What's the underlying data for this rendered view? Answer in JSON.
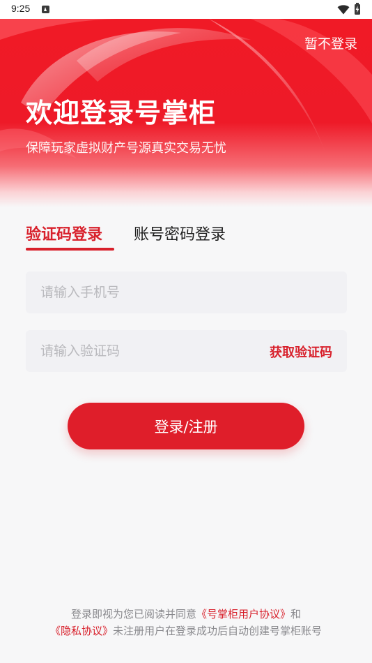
{
  "status_bar": {
    "time": "9:25"
  },
  "header": {
    "skip_label": "暂不登录",
    "title": "欢迎登录号掌柜",
    "subtitle": "保障玩家虚拟财产号源真实交易无忧"
  },
  "tabs": [
    {
      "label": "验证码登录",
      "active": true
    },
    {
      "label": "账号密码登录",
      "active": false
    }
  ],
  "form": {
    "phone_placeholder": "请输入手机号",
    "code_placeholder": "请输入验证码",
    "get_code_label": "获取验证码",
    "submit_label": "登录/注册"
  },
  "agreement": {
    "prefix": "登录即视为您已阅读并同意",
    "user_agreement": "《号掌柜用户协议》",
    "and": "和",
    "privacy_policy": "《隐私协议》",
    "suffix": "未注册用户在登录成功后自动创建号掌柜账号"
  },
  "colors": {
    "accent": "#d8202b",
    "hero_red": "#f01a26",
    "background": "#f7f7f8",
    "input_bg": "#f1f1f4"
  },
  "icons": [
    "notification-icon",
    "wifi-icon",
    "battery-icon"
  ]
}
